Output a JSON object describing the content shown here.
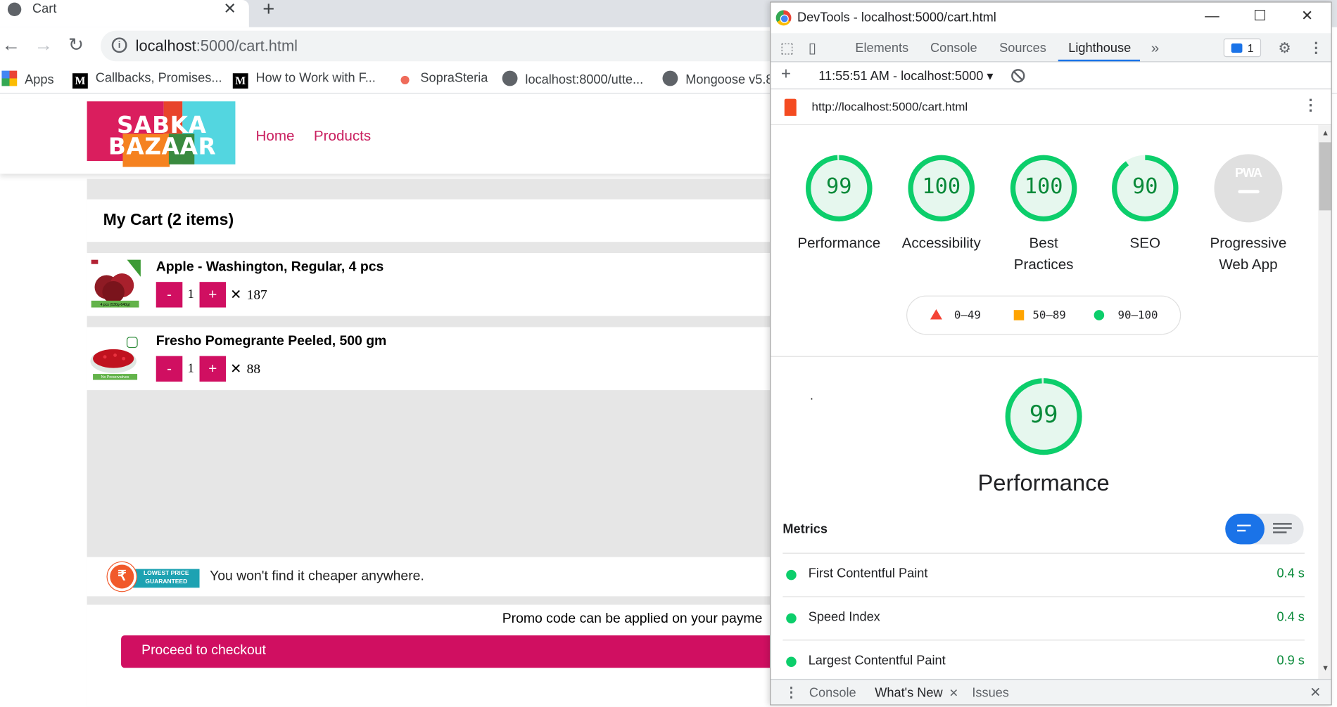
{
  "browser": {
    "tab_title": "Cart",
    "url_host": "localhost",
    "url_rest": ":5000/cart.html",
    "bookmarks": [
      {
        "label": "Apps",
        "icon": "apps-icon"
      },
      {
        "label": "Callbacks, Promises...",
        "icon": "medium-icon"
      },
      {
        "label": "How to Work with F...",
        "icon": "medium-icon"
      },
      {
        "label": "SopraSteria",
        "icon": "soprasteria-icon"
      },
      {
        "label": "localhost:8000/utte...",
        "icon": "globe-icon"
      },
      {
        "label": "Mongoose v5.8",
        "icon": "globe-icon"
      }
    ]
  },
  "site": {
    "logo_line1": "SABKA",
    "logo_line2": "BAZAAR",
    "nav": [
      "Home",
      "Products"
    ],
    "cart_title": "My Cart (2 items)",
    "items": [
      {
        "name": "Apple - Washington, Regular, 4 pcs",
        "qty": "1",
        "price": "187",
        "minus": "-",
        "plus": "+"
      },
      {
        "name": "Fresho Pomegrante Peeled, 500 gm",
        "qty": "1",
        "price": "88",
        "minus": "-",
        "plus": "+"
      }
    ],
    "promo_badge_line1": "LOWEST PRICE",
    "promo_badge_line2": "GUARANTEED",
    "promo_text": "You won't find it cheaper anywhere.",
    "promo_note": "Promo code can be applied on your payme",
    "checkout_label": "Proceed to checkout",
    "apple_tag": "4 pcs (530g-640g)",
    "pom_tag": "No Preservatives"
  },
  "devtools": {
    "window_title": "DevTools - localhost:5000/cart.html",
    "tabs": [
      "Elements",
      "Console",
      "Sources",
      "Lighthouse"
    ],
    "active_tab": "Lighthouse",
    "issues_count": "1",
    "report_select": "11:55:51 AM - localhost:5000",
    "report_url": "http://localhost:5000/cart.html",
    "scores": [
      {
        "value": "99",
        "label": "Performance",
        "score": 0.99
      },
      {
        "value": "100",
        "label": "Accessibility",
        "score": 1.0
      },
      {
        "value": "100",
        "label": "Best Practices",
        "score": 1.0
      },
      {
        "value": "90",
        "label": "SEO",
        "score": 0.9
      }
    ],
    "pwa_label": "Progressive Web App",
    "pwa_badge": "PWA",
    "legend": [
      "0–49",
      "50–89",
      "90–100"
    ],
    "perf_score": "99",
    "perf_score_value": 0.99,
    "perf_title": "Performance",
    "dot_text": ".",
    "metrics_heading": "Metrics",
    "metrics": [
      {
        "name": "First Contentful Paint",
        "value": "0.4 s"
      },
      {
        "name": "Speed Index",
        "value": "0.4 s"
      },
      {
        "name": "Largest Contentful Paint",
        "value": "0.9 s"
      }
    ],
    "drawer_tabs": [
      "Console",
      "What's New",
      "Issues"
    ],
    "colors": {
      "pass": "#0cce6b",
      "average": "#ffa400",
      "fail": "#f44336",
      "accent": "#1a73e8",
      "brand": "#d00f61"
    }
  }
}
